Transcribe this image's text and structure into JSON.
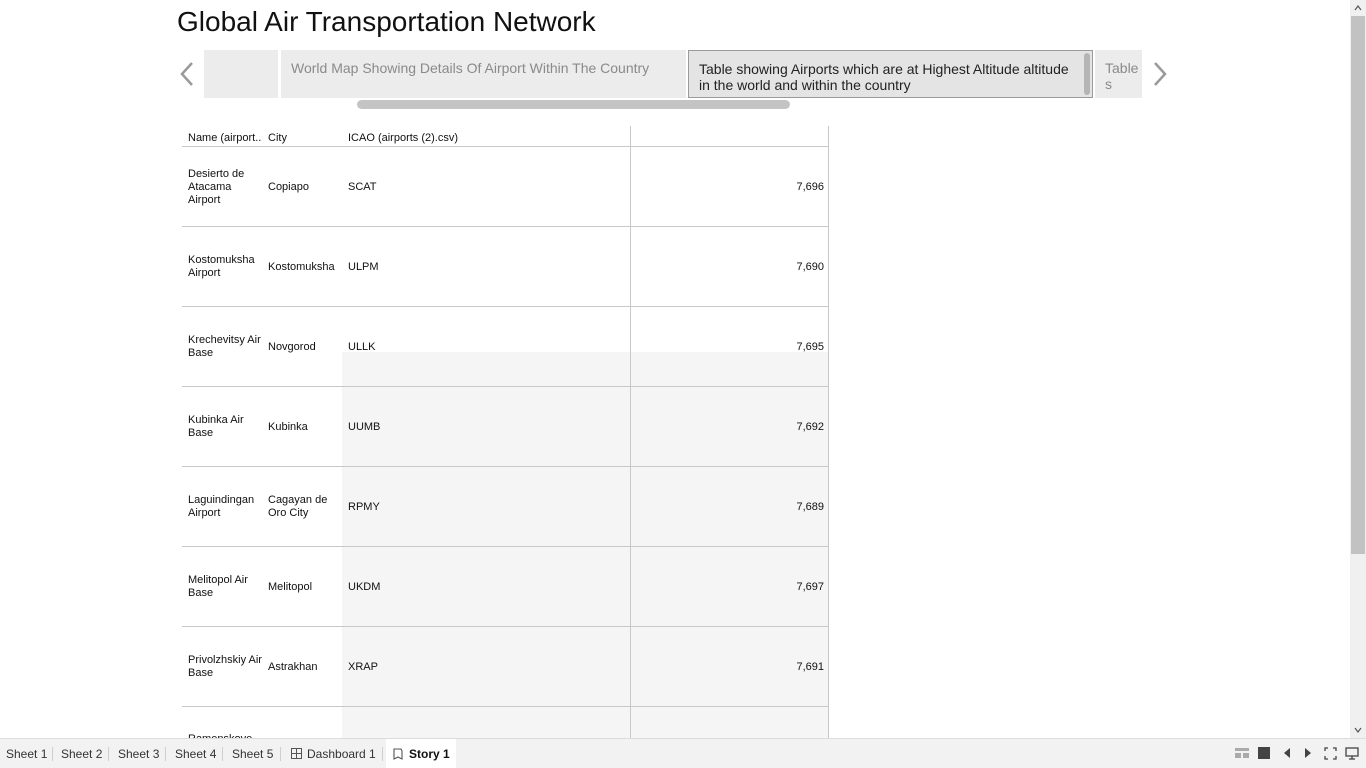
{
  "story": {
    "title": "Global Air Transportation Network"
  },
  "story_points": [
    {
      "label": ""
    },
    {
      "label": "World Map Showing Details Of Airport Within The Country"
    },
    {
      "label": "Table showing Airports which are at Highest Altitude altitude in the world and within the country"
    },
    {
      "label": "Table s"
    }
  ],
  "table": {
    "headers": [
      "Name (airport..",
      "City",
      "ICAO (airports (2).csv)",
      ""
    ],
    "rows": [
      {
        "name": "Desierto de Atacama Airport",
        "city": "Copiapo",
        "icao": "SCAT",
        "value": "7,696"
      },
      {
        "name": "Kostomuksha Airport",
        "city": "Kostomuksha",
        "icao": "ULPM",
        "value": "7,690"
      },
      {
        "name": "Krechevitsy Air Base",
        "city": "Novgorod",
        "icao": "ULLK",
        "value": "7,695"
      },
      {
        "name": "Kubinka Air Base",
        "city": "Kubinka",
        "icao": "UUMB",
        "value": "7,692"
      },
      {
        "name": "Laguindingan Airport",
        "city": "Cagayan de Oro City",
        "icao": "RPMY",
        "value": "7,689"
      },
      {
        "name": "Melitopol Air Base",
        "city": "Melitopol",
        "icao": "UKDM",
        "value": "7,697"
      },
      {
        "name": "Privolzhskiy Air Base",
        "city": "Astrakhan",
        "icao": "XRAP",
        "value": "7,691"
      },
      {
        "name": "Ramenskoye",
        "city": "",
        "icao": "",
        "value": ""
      }
    ]
  },
  "tabs": [
    {
      "label": "Sheet 1",
      "icon": ""
    },
    {
      "label": "Sheet 2",
      "icon": ""
    },
    {
      "label": "Sheet 3",
      "icon": ""
    },
    {
      "label": "Sheet 4",
      "icon": ""
    },
    {
      "label": "Sheet 5",
      "icon": ""
    },
    {
      "label": "Dashboard 1",
      "icon": "dashboard-icon"
    },
    {
      "label": "Story 1",
      "icon": "story-icon",
      "active": true
    }
  ],
  "colors": {
    "active_point_bg": "#e4e4e4",
    "inactive_point_bg": "#ececec",
    "row_shade": "#f5f5f5",
    "gridline": "#c8c8c8"
  }
}
